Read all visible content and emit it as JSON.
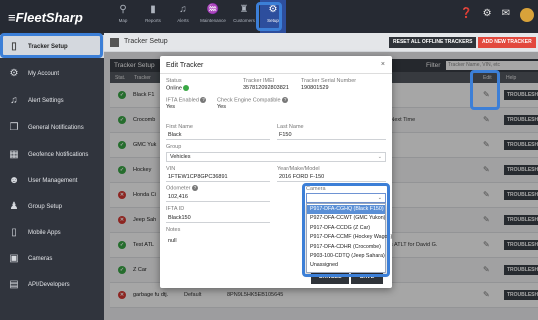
{
  "app": {
    "logo": "≡FleetSharp",
    "nav": [
      {
        "label": "Map",
        "icon": "person-pin-icon",
        "glyph": "⚲"
      },
      {
        "label": "Reports",
        "icon": "bar-chart-icon",
        "glyph": "▮"
      },
      {
        "label": "Alerts",
        "icon": "bell-icon",
        "glyph": "♫"
      },
      {
        "label": "Maintenance",
        "icon": "wrench-icon",
        "glyph": "♒"
      },
      {
        "label": "Customers",
        "icon": "people-icon",
        "glyph": "♜"
      },
      {
        "label": "Setup",
        "icon": "gear-icon",
        "glyph": "⚙"
      }
    ]
  },
  "sidebar": {
    "items": [
      {
        "label": "Tracker Setup",
        "glyph": "▯"
      },
      {
        "label": "My Account",
        "glyph": "⚙"
      },
      {
        "label": "Alert Settings",
        "glyph": "♫"
      },
      {
        "label": "General Notifications",
        "glyph": "❐"
      },
      {
        "label": "Geofence Notifications",
        "glyph": "▦"
      },
      {
        "label": "User Management",
        "glyph": "☻"
      },
      {
        "label": "Group Setup",
        "glyph": "♟"
      },
      {
        "label": "Mobile Apps",
        "glyph": "▯"
      },
      {
        "label": "Cameras",
        "glyph": "▣"
      },
      {
        "label": "API/Developers",
        "glyph": "▤"
      }
    ]
  },
  "header": {
    "title": "Tracker Setup",
    "reset_label": "RESET ALL OFFLINE TRACKERS",
    "add_label": "ADD NEW TRACKER"
  },
  "table": {
    "title": "Tracker Setup",
    "filter_label": "Filter",
    "filter_placeholder": "Tracker Name, VIN, etc",
    "headers": [
      "Stat.",
      "Tracker",
      "Edit",
      "Help"
    ],
    "help_label": "TROUBLESH",
    "rows": [
      {
        "status": "ok",
        "name": "Black F1"
      },
      {
        "status": "ok",
        "name": "Crocomb",
        "note": "ilter Next Time"
      },
      {
        "status": "ok",
        "name": "GMC Yuk"
      },
      {
        "status": "ok",
        "name": "Hockey"
      },
      {
        "status": "bad",
        "name": "Honda Ci"
      },
      {
        "status": "bad",
        "name": "Jeep Sah"
      },
      {
        "status": "ok",
        "name": "Test ATL",
        "note": "s ATLT for David G."
      },
      {
        "status": "ok",
        "name": "Z Car"
      },
      {
        "status": "bad",
        "name": "garbage fu dtj.",
        "extra": "Default",
        "serial": "8PN9L5HK5EB105645"
      }
    ]
  },
  "modal": {
    "title": "Edit Tracker",
    "close": "×",
    "status_label": "Status",
    "status_value": "Online",
    "imei_label": "Tracker IMEI",
    "imei_value": "357812092803821",
    "serial_label": "Tracker Serial Number",
    "serial_value": "190801529",
    "ifta_label": "IFTA Enabled",
    "ifta_value": "Yes",
    "ce_label": "Check Engine Compatible",
    "ce_value": "Yes",
    "first_label": "First Name",
    "first_value": "Black",
    "last_label": "Last Name",
    "last_value": "F150",
    "group_label": "Group",
    "group_value": "Vehicles",
    "vin_label": "VIN",
    "vin_value": "1FTEW1CP8GPC36891",
    "ymm_label": "Year/Make/Model",
    "ymm_value": "2016 FORD F-150",
    "odo_label": "Odometer",
    "odo_value": "102,416",
    "ifta_id_label": "IFTA ID",
    "ifta_id_value": "Black150",
    "notes_label": "Notes",
    "notes_value": "null",
    "camera_label": "Camera",
    "camera_options": [
      "P917-DFA-CGHQ (Black F150)",
      "P927-DFA-CCWT (GMC Yukon)",
      "P917-DFA-CCDG (Z Car)",
      "P917-DFA-CCMF (Hockey Wagon)",
      "P917-DFA-CDHR (Crocombe)",
      "P903-100-CDTQ (Jeep Sahara)",
      "Unassigned"
    ],
    "cancel_label": "CANCEL",
    "save_label": "SAVE"
  }
}
